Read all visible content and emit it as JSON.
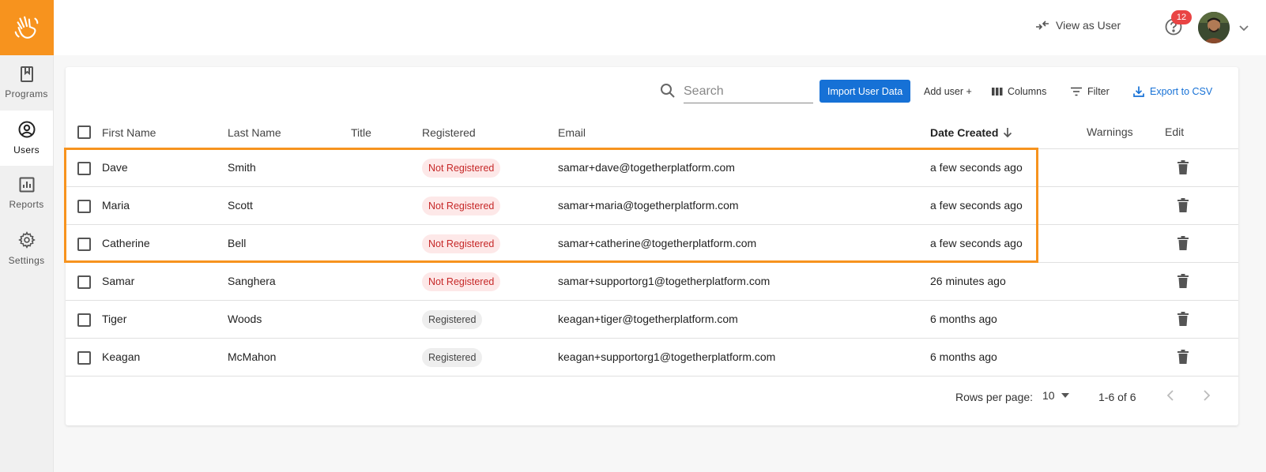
{
  "sidebar": {
    "logo": "hand-wave-logo",
    "items": [
      {
        "label": "Programs",
        "icon": "book-icon"
      },
      {
        "label": "Users",
        "icon": "user-circle-icon"
      },
      {
        "label": "Reports",
        "icon": "bar-chart-icon"
      },
      {
        "label": "Settings",
        "icon": "gear-icon"
      }
    ]
  },
  "topbar": {
    "view_as_user": "View as User",
    "notifications_count": "12"
  },
  "toolbar": {
    "search_placeholder": "Search",
    "import_label": "Import User Data",
    "add_user_label": "Add user +",
    "columns_label": "Columns",
    "filter_label": "Filter",
    "export_label": "Export to CSV"
  },
  "table": {
    "headers": {
      "first_name": "First Name",
      "last_name": "Last Name",
      "title": "Title",
      "registered": "Registered",
      "email": "Email",
      "date_created": "Date Created",
      "warnings": "Warnings",
      "edit": "Edit"
    },
    "rows": [
      {
        "first": "Dave",
        "last": "Smith",
        "title": "",
        "status": "Not Registered",
        "email": "samar+dave@togetherplatform.com",
        "created": "a few seconds ago"
      },
      {
        "first": "Maria",
        "last": "Scott",
        "title": "",
        "status": "Not Registered",
        "email": "samar+maria@togetherplatform.com",
        "created": "a few seconds ago"
      },
      {
        "first": "Catherine",
        "last": "Bell",
        "title": "",
        "status": "Not Registered",
        "email": "samar+catherine@togetherplatform.com",
        "created": "a few seconds ago"
      },
      {
        "first": "Samar",
        "last": "Sanghera",
        "title": "",
        "status": "Not Registered",
        "email": "samar+supportorg1@togetherplatform.com",
        "created": "26 minutes ago"
      },
      {
        "first": "Tiger",
        "last": "Woods",
        "title": "",
        "status": "Registered",
        "email": "keagan+tiger@togetherplatform.com",
        "created": "6 months ago"
      },
      {
        "first": "Keagan",
        "last": "McMahon",
        "title": "",
        "status": "Registered",
        "email": "keagan+supportorg1@togetherplatform.com",
        "created": "6 months ago"
      }
    ]
  },
  "footer": {
    "rows_per_page_label": "Rows per page:",
    "rows_per_page_value": "10",
    "range": "1-6 of 6"
  },
  "colors": {
    "brand": "#f7931e",
    "primary": "#1671d6",
    "danger": "#c62828"
  }
}
